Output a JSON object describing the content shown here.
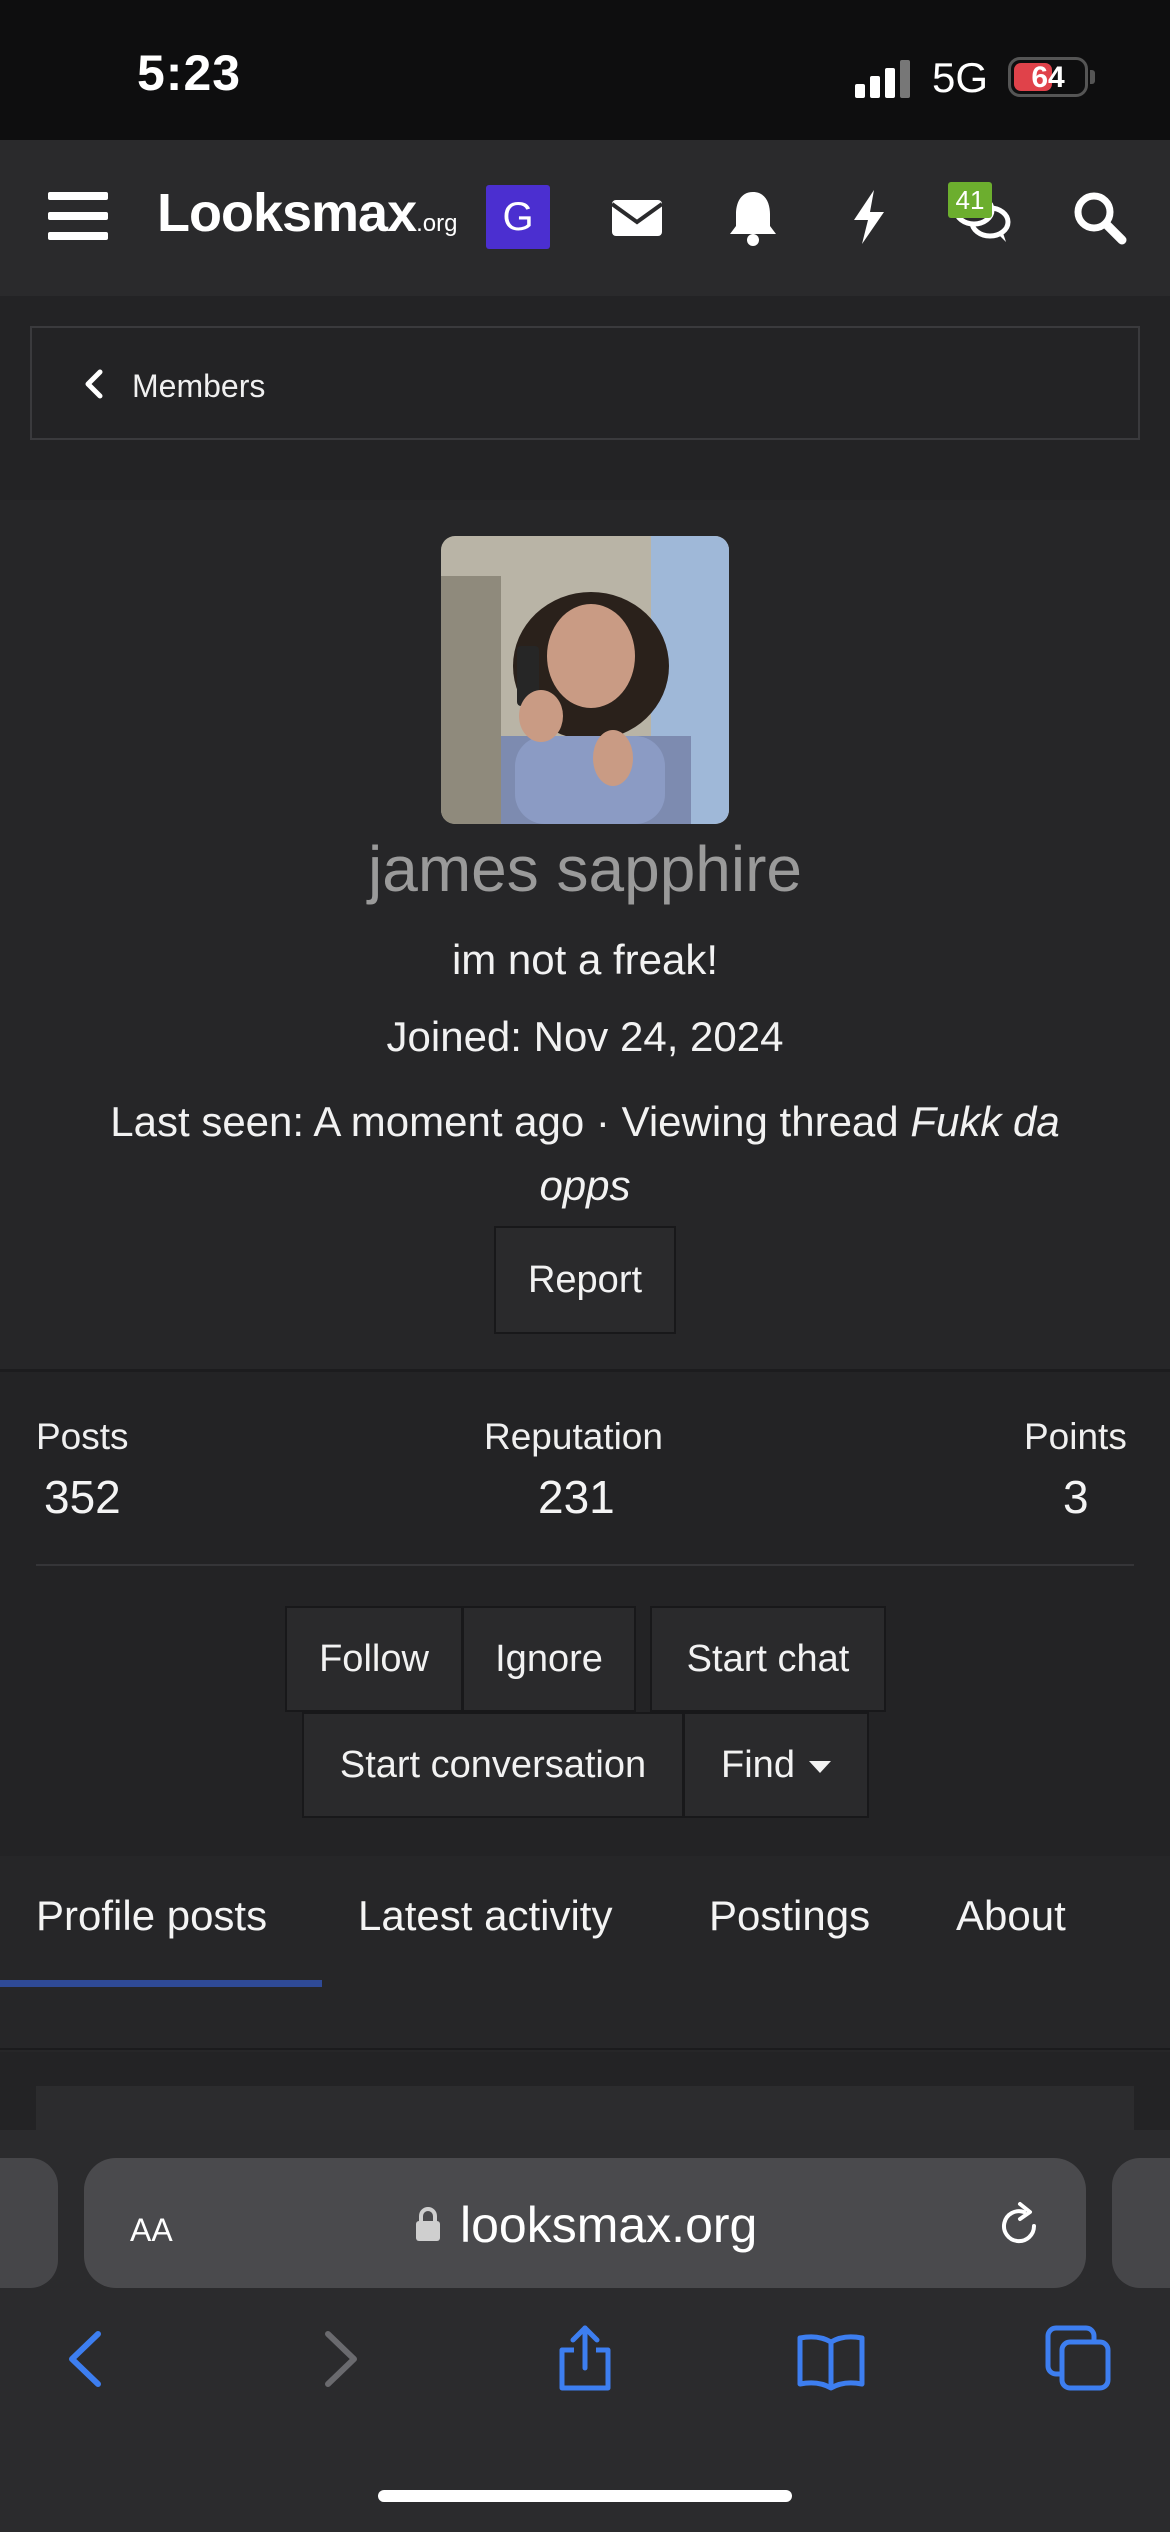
{
  "status_bar": {
    "time": "5:23",
    "network": "5G",
    "battery": "64"
  },
  "header": {
    "logo_main": "Looksmax",
    "logo_suffix": ".org",
    "g_badge": "G",
    "chat_count": "41",
    "icons": [
      "menu-icon",
      "envelope-icon",
      "bell-icon",
      "bolt-icon",
      "chat-icon",
      "search-icon"
    ]
  },
  "breadcrumb": {
    "label": "Members"
  },
  "profile": {
    "username": "james sapphire",
    "title": "im not a freak!",
    "joined": "Joined: Nov 24, 2024",
    "last_seen_prefix": "Last seen: A moment ago · Viewing thread ",
    "last_seen_thread": "Fukk da opps",
    "report": "Report"
  },
  "stats": [
    {
      "label": "Posts",
      "value": "352"
    },
    {
      "label": "Reputation",
      "value": "231"
    },
    {
      "label": "Points",
      "value": "3"
    }
  ],
  "actions": {
    "follow": "Follow",
    "ignore": "Ignore",
    "start_chat": "Start chat",
    "start_conversation": "Start conversation",
    "find": "Find"
  },
  "tabs": [
    "Profile posts",
    "Latest activity",
    "Postings",
    "About"
  ],
  "active_tab": "Profile posts",
  "browser": {
    "text_size": "AA",
    "url": "looksmax.org"
  },
  "colors": {
    "accent": "#2f4a96",
    "badge_purple": "#4b2fd0",
    "badge_green": "#6cae2e",
    "browser_blue": "#3d7ef0"
  }
}
